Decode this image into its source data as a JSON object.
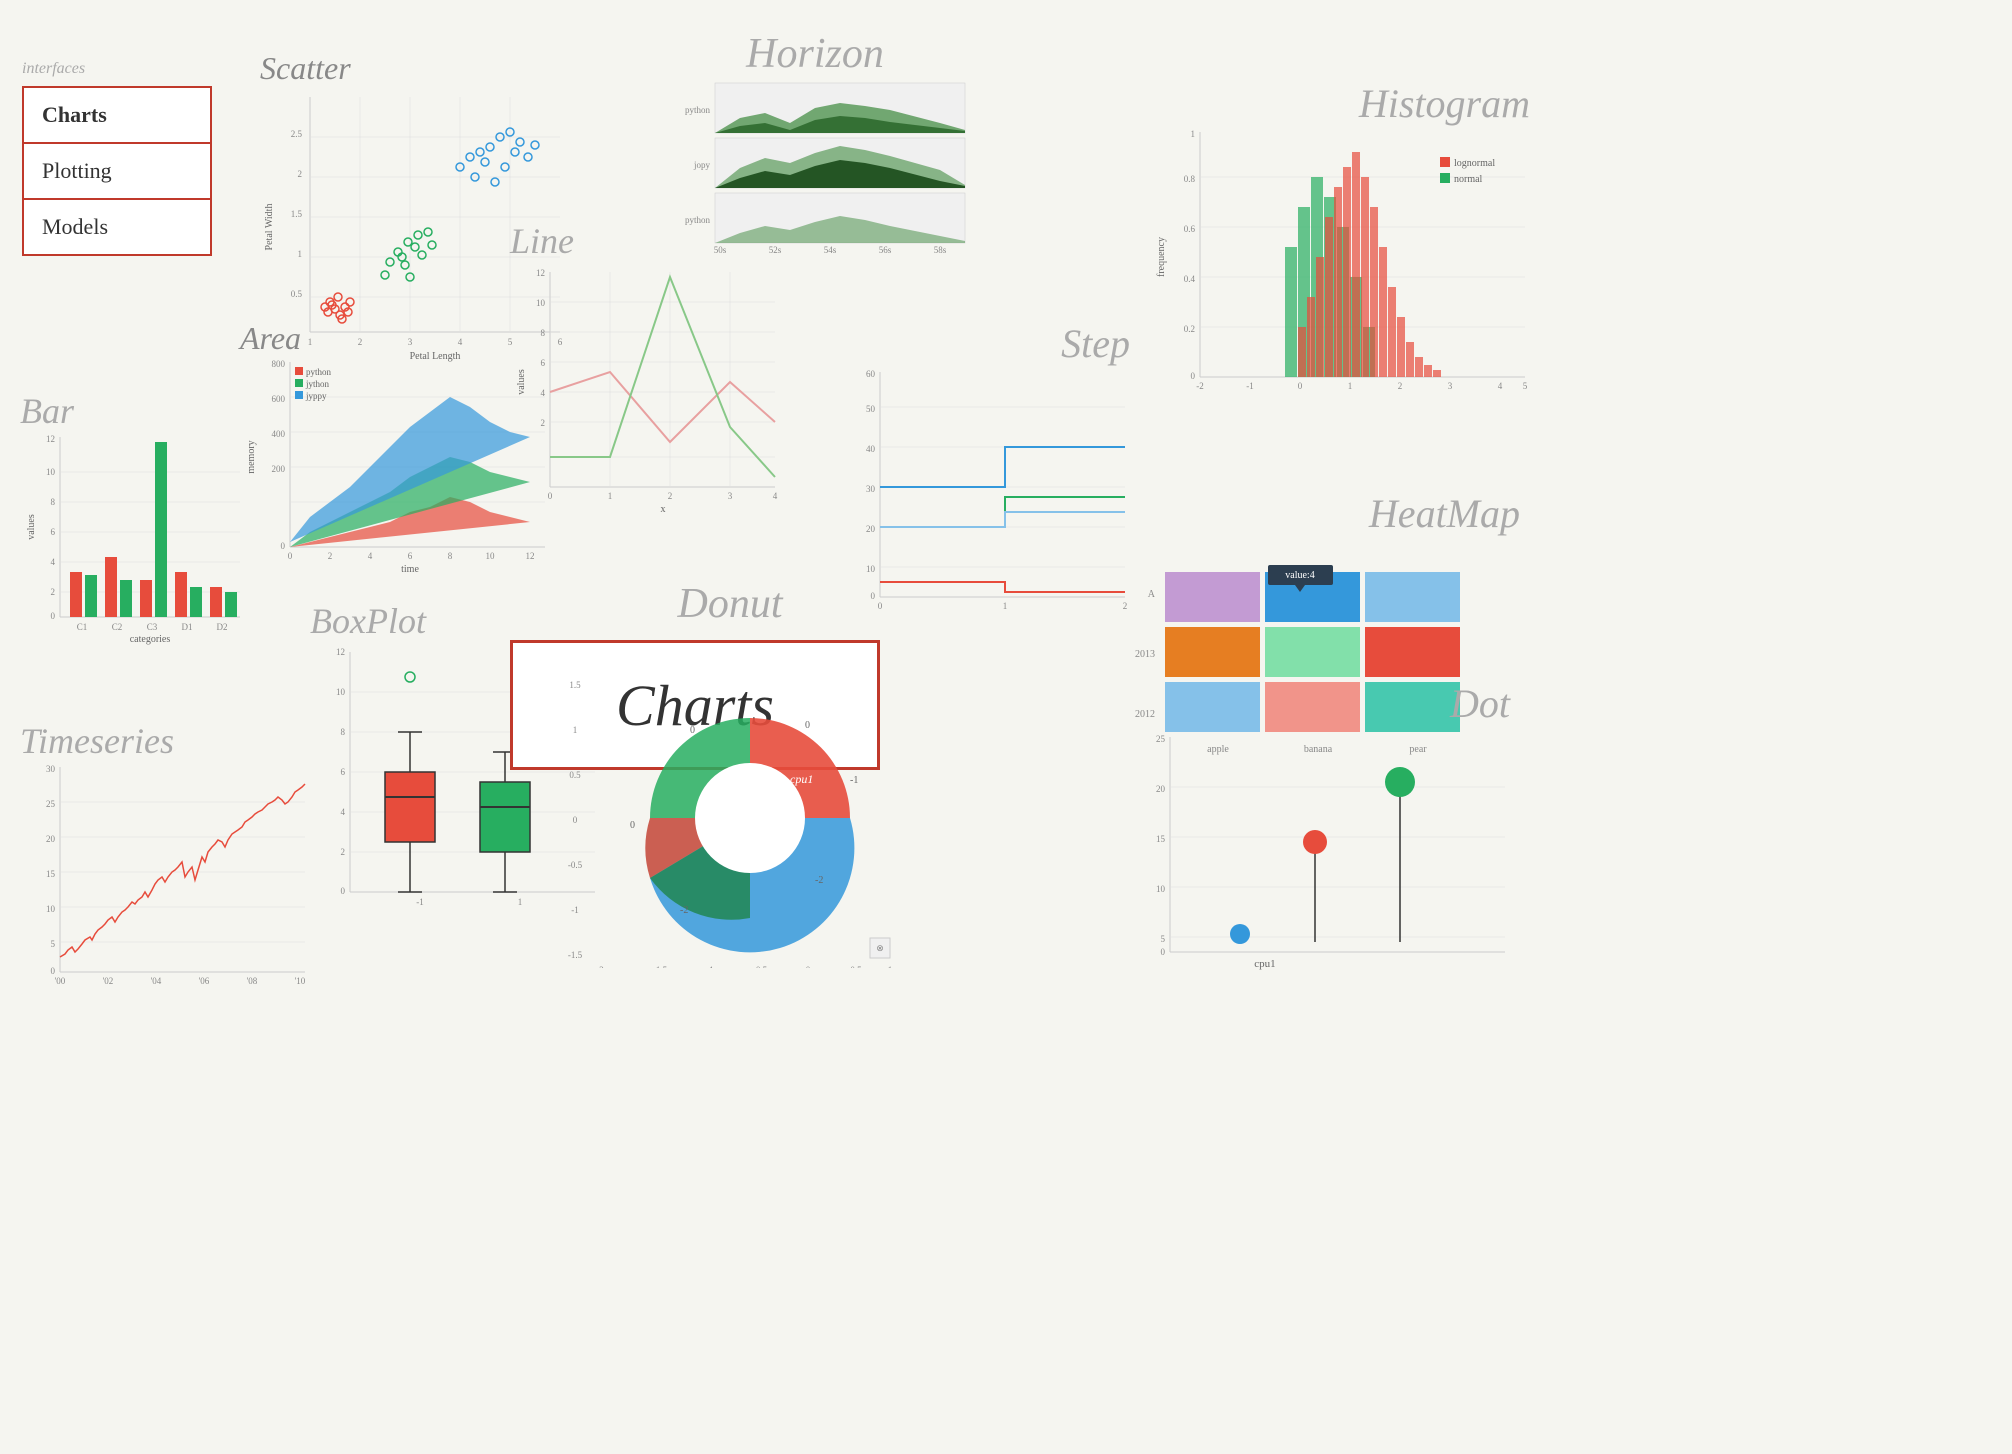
{
  "sidebar": {
    "interfaces_label": "interfaces",
    "items": [
      {
        "label": "Charts",
        "active": true
      },
      {
        "label": "Plotting",
        "active": false
      },
      {
        "label": "Models",
        "active": false
      }
    ]
  },
  "charts": {
    "center_label": "Charts",
    "titles": {
      "scatter": "Scatter",
      "area": "Area",
      "bar": "Bar",
      "timeseries": "Timeseries",
      "boxplot": "BoxPlot",
      "line": "Line",
      "horizon": "Horizon",
      "step": "Step",
      "histogram": "Histogram",
      "heatmap": "HeatMap",
      "donut": "Donut",
      "dot": "Dot"
    }
  }
}
